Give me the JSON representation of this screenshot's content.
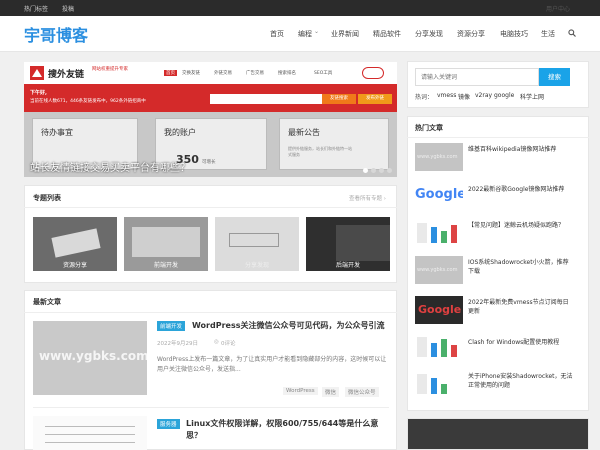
{
  "topbar": {
    "links": [
      "热门标签",
      "投稿"
    ],
    "right": "用户中心"
  },
  "site": {
    "logo": "宇哥博客"
  },
  "nav": {
    "items": [
      "首页",
      "编程",
      "业界新闻",
      "精品软件",
      "分享发现",
      "资源分享",
      "电脑技巧",
      "生活"
    ],
    "dropdown_marker": "⌄"
  },
  "banner": {
    "logo_text": "搜外友链",
    "logo_sub": "网站权重提升专家",
    "site_tabs": [
      "首页",
      "交换友链",
      "外链交易",
      "广告交易",
      "搜索排名",
      "SEO工具"
    ],
    "welcome": "下午好,",
    "stats": "当前在线人数671，446条友链发布中，962条外链招商中",
    "search_button": "友链搜索",
    "publish_button": "发布外链",
    "boxes": [
      "待办事宜",
      "我的账户",
      "最新公告"
    ],
    "notice": "提供外链服务，站长们和外链特一站式服务",
    "amount": "350",
    "amount_unit": "可增长",
    "caption": "站长友情链接交易买卖平台有哪些？"
  },
  "topics": {
    "title": "专题列表",
    "more": "查看所有专题 ›",
    "items": [
      "资源分享",
      "前端开发",
      "分享发现",
      "后端开发"
    ]
  },
  "latest": {
    "title": "最新文章",
    "articles": [
      {
        "tag": "前端开发",
        "title": "WordPress关注微信公众号可见代码，为公众号引流",
        "date": "2022年9月29日",
        "comments": "0评论",
        "excerpt": "WordPress上发布一篇文章，为了让真实用户才能看到隐藏部分的内容，这时候可以让用户关注微信公众号，发送指...",
        "tags": [
          "WordPress",
          "微信",
          "微信公众号"
        ],
        "watermark": "www.ygbks.com"
      },
      {
        "tag": "服务器",
        "title": "Linux文件权限详解，权限600/755/644等是什么意思？",
        "date": "",
        "comments": "",
        "excerpt": "",
        "tags": [],
        "watermark": ""
      }
    ]
  },
  "search": {
    "placeholder": "请输入关键词",
    "button": "搜索",
    "hot_label": "热词：",
    "hot_words": [
      "vmess",
      "镜像",
      "v2ray",
      "google",
      "科学上网"
    ]
  },
  "hot_articles": {
    "title": "热门文章",
    "items": [
      {
        "text": "维基百科wikipedia镜像网站推荐",
        "thumb": "www.ygbks.com"
      },
      {
        "text": "2022最新谷歌Google镜像网站推荐",
        "thumb": "Google"
      },
      {
        "text": "【常见问题】迷鲸云机场疑似跑路？",
        "thumb": ""
      },
      {
        "text": "IOS系统Shadowrocket小火箭，推荐下载",
        "thumb": "www.ygbks.com"
      },
      {
        "text": "2022年最新免费vmess节点订阅每日更新",
        "thumb": "Google"
      },
      {
        "text": "Clash for Windows配置使用教程",
        "thumb": ""
      },
      {
        "text": "关于iPhone安装Shadowrocket，无法正常使用的问题",
        "thumb": "www.ygbks.com"
      }
    ]
  },
  "colors": {
    "accent": "#2b8fe0",
    "tag": "#2ba4d9",
    "banner_red": "#d42a2a"
  }
}
